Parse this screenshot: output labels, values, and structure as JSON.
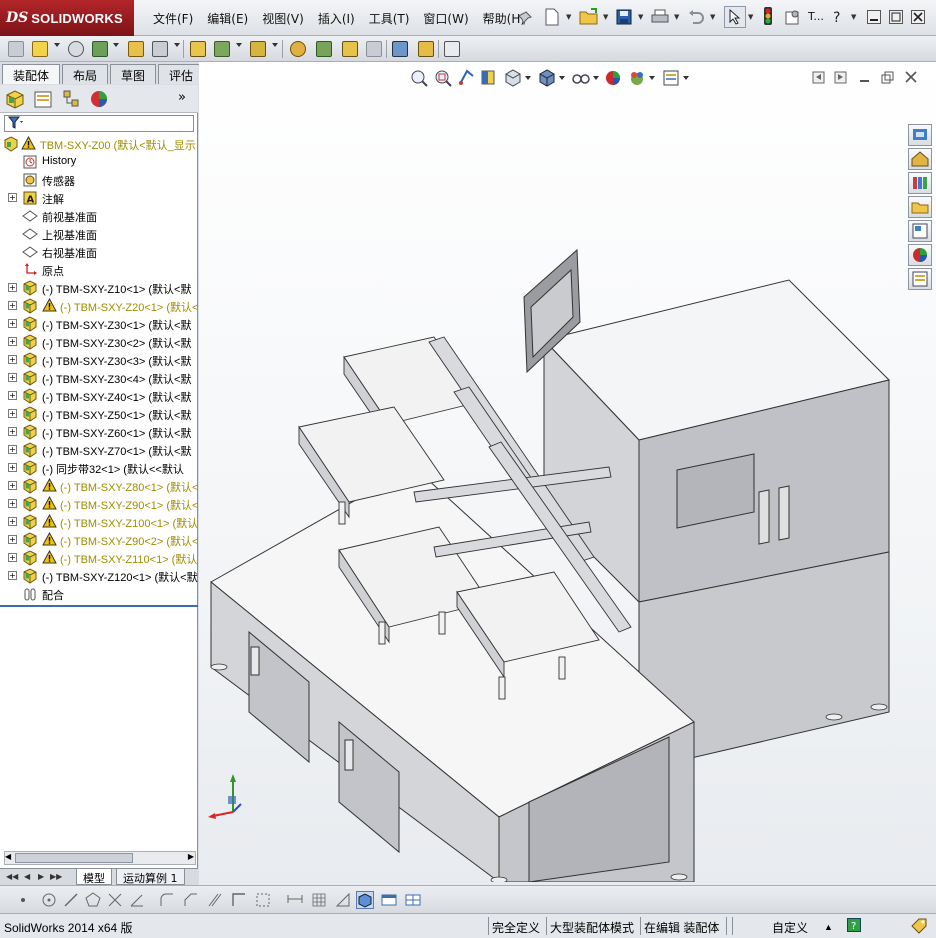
{
  "app": {
    "logo_prefix": "DS",
    "logo_name": "SOLIDWORKS",
    "title_tail": "T..."
  },
  "menu": [
    "文件(F)",
    "编辑(E)",
    "视图(V)",
    "插入(I)",
    "工具(T)",
    "窗口(W)",
    "帮助(H)"
  ],
  "command_tabs": [
    "装配体",
    "布局",
    "草图",
    "评估"
  ],
  "active_command_tab": "装配体",
  "feature_tree": {
    "more_glyph": "»",
    "root": "TBM-SXY-Z00 (默认<默认_显示",
    "items": [
      {
        "label": "History",
        "icon": "history-icon",
        "expand": false,
        "warn": false,
        "yellow": false
      },
      {
        "label": "传感器",
        "icon": "sensor-icon",
        "expand": false,
        "warn": false,
        "yellow": false
      },
      {
        "label": "注解",
        "icon": "annotation-icon",
        "expand": true,
        "warn": false,
        "yellow": false
      },
      {
        "label": "前视基准面",
        "icon": "plane-icon",
        "expand": false,
        "warn": false,
        "yellow": false
      },
      {
        "label": "上视基准面",
        "icon": "plane-icon",
        "expand": false,
        "warn": false,
        "yellow": false
      },
      {
        "label": "右视基准面",
        "icon": "plane-icon",
        "expand": false,
        "warn": false,
        "yellow": false
      },
      {
        "label": "原点",
        "icon": "origin-icon",
        "expand": false,
        "warn": false,
        "yellow": false
      },
      {
        "label": "(-) TBM-SXY-Z10<1> (默认<默",
        "icon": "part-icon",
        "expand": true,
        "warn": false,
        "yellow": false
      },
      {
        "label": "(-) TBM-SXY-Z20<1> (默认<",
        "icon": "part-icon",
        "expand": true,
        "warn": true,
        "yellow": true
      },
      {
        "label": "(-) TBM-SXY-Z30<1> (默认<默",
        "icon": "part-icon",
        "expand": true,
        "warn": false,
        "yellow": false
      },
      {
        "label": "(-) TBM-SXY-Z30<2> (默认<默",
        "icon": "part-icon",
        "expand": true,
        "warn": false,
        "yellow": false
      },
      {
        "label": "(-) TBM-SXY-Z30<3> (默认<默",
        "icon": "part-icon",
        "expand": true,
        "warn": false,
        "yellow": false
      },
      {
        "label": "(-) TBM-SXY-Z30<4> (默认<默",
        "icon": "part-icon",
        "expand": true,
        "warn": false,
        "yellow": false
      },
      {
        "label": "(-) TBM-SXY-Z40<1> (默认<默",
        "icon": "part-icon",
        "expand": true,
        "warn": false,
        "yellow": false
      },
      {
        "label": "(-) TBM-SXY-Z50<1> (默认<默",
        "icon": "part-icon",
        "expand": true,
        "warn": false,
        "yellow": false
      },
      {
        "label": "(-) TBM-SXY-Z60<1> (默认<默",
        "icon": "part-icon",
        "expand": true,
        "warn": false,
        "yellow": false
      },
      {
        "label": "(-) TBM-SXY-Z70<1> (默认<默",
        "icon": "part-icon",
        "expand": true,
        "warn": false,
        "yellow": false
      },
      {
        "label": "(-) 同步带32<1> (默认<<默认",
        "icon": "part-icon",
        "expand": true,
        "warn": false,
        "yellow": false
      },
      {
        "label": "(-) TBM-SXY-Z80<1> (默认<",
        "icon": "part-icon",
        "expand": true,
        "warn": true,
        "yellow": true
      },
      {
        "label": "(-) TBM-SXY-Z90<1> (默认<",
        "icon": "part-icon",
        "expand": true,
        "warn": true,
        "yellow": true
      },
      {
        "label": "(-) TBM-SXY-Z100<1> (默认",
        "icon": "part-icon",
        "expand": true,
        "warn": true,
        "yellow": true
      },
      {
        "label": "(-) TBM-SXY-Z90<2> (默认<",
        "icon": "part-icon",
        "expand": true,
        "warn": true,
        "yellow": true
      },
      {
        "label": "(-) TBM-SXY-Z110<1> (默认",
        "icon": "part-icon",
        "expand": true,
        "warn": true,
        "yellow": true
      },
      {
        "label": "(-) TBM-SXY-Z120<1> (默认<默",
        "icon": "part-icon",
        "expand": true,
        "warn": false,
        "yellow": false
      },
      {
        "label": "配合",
        "icon": "mates-icon",
        "expand": false,
        "warn": false,
        "yellow": false
      }
    ]
  },
  "model_tabs": [
    "模型",
    "运动算例 1"
  ],
  "status": {
    "left": "SolidWorks 2014 x64 版",
    "s1": "完全定义",
    "s2": "大型装配体模式",
    "s3": "在编辑 装配体",
    "s4": "自定义",
    "s4_arrow": "▲"
  },
  "colors": {
    "yellow_text": "#a08c00",
    "warning": "#f5c400",
    "logo_red": "#a11d21"
  }
}
